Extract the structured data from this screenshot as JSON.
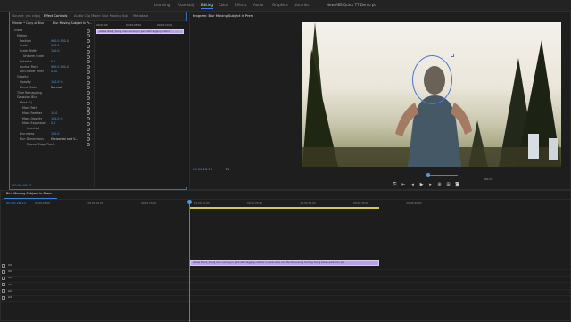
{
  "workspaces": [
    "Learning",
    "Assembly",
    "Editing",
    "Color",
    "Effects",
    "Audio",
    "Graphics",
    "Libraries"
  ],
  "active_workspace": "Editing",
  "header_title": "New AEE Quick TT Demo pt",
  "left_tabs": [
    "Source: (no clips)",
    "Effect Controls",
    "Audio Clip Mixer: Blur Moving Subject in Prem",
    "Metadata"
  ],
  "ec_source": "Master * Copy of Blur",
  "ec_clip": "Blur Moving Subject in Pr...",
  "timecodes_small": [
    "00:00:00",
    "00:00:05:00",
    "00:00:10:00"
  ],
  "ec_clip_label": "Adobe Stock_Young man running in park with tagging outdoor",
  "effects": [
    {
      "name": "Video",
      "value": ""
    },
    {
      "name": "Motion",
      "value": ""
    },
    {
      "name": "Position",
      "value": "960.0   540.0"
    },
    {
      "name": "Scale",
      "value": "100.0"
    },
    {
      "name": "Scale Width",
      "value": "100.0"
    },
    {
      "name": "Uniform Scale",
      "value": ""
    },
    {
      "name": "Rotation",
      "value": "0.0"
    },
    {
      "name": "Anchor Point",
      "value": "960.0   540.0"
    },
    {
      "name": "Anti-flicker Filter",
      "value": "0.00"
    },
    {
      "name": "Opacity",
      "value": ""
    },
    {
      "name": "Opacity",
      "value": "100.0 %"
    },
    {
      "name": "Blend Mode",
      "value": "Normal"
    },
    {
      "name": "Time Remapping",
      "value": ""
    },
    {
      "name": "Gaussian Blur",
      "value": ""
    },
    {
      "name": "Mask (1)",
      "value": ""
    },
    {
      "name": "Mask Path",
      "value": ""
    },
    {
      "name": "Mask Feather",
      "value": "10.0"
    },
    {
      "name": "Mask Opacity",
      "value": "100.0 %"
    },
    {
      "name": "Mask Expansion",
      "value": "0.0"
    },
    {
      "name": "Inverted",
      "value": ""
    },
    {
      "name": "Blurriness",
      "value": "100.0"
    },
    {
      "name": "Blur Dimensions",
      "value": "Horizontal and V..."
    },
    {
      "name": "Repeat Edge Pixels",
      "value": ""
    }
  ],
  "ec_timecode": "00:00:00:21",
  "program_title": "Program: Blur Moving Subject in Prem",
  "program_timecode": "00:00:28:13",
  "program_fit": "Fit",
  "program_duration": "00:01",
  "sequence_tab": "Blur Moving Subject in Prem",
  "seq_timecode": "00:00:28:13",
  "ruler_marks": [
    "00:00:05:00",
    "00:00:10:00",
    "00:00:15:00",
    "00:00:20:00",
    "00:00:25:00",
    "00:00:30:00",
    "00:00:35:00",
    "00:00:40:00"
  ],
  "clip_label": "Adobe Stock_Young man running in park with tagging outdoor in park,video one the for running holding Young bluish park.mov [V]",
  "track_labels": [
    "V3",
    "V2",
    "V1",
    "A1",
    "A2",
    "A3"
  ],
  "colors": {
    "accent": "#3b82d8",
    "clip": "#b7a2e4",
    "mask": "#4b78d0",
    "timecode": "#4d9be6"
  }
}
